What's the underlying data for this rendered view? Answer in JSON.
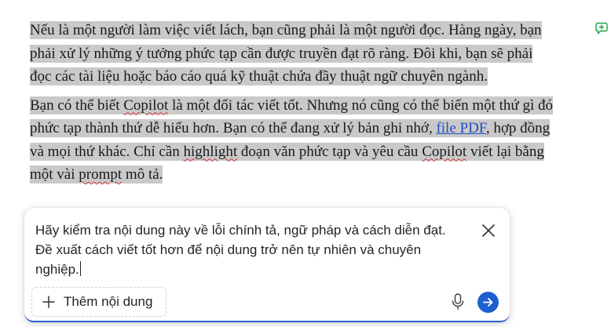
{
  "document": {
    "paragraph1": "Nếu là một người làm việc viết lách, bạn cũng phải là một người đọc. Hàng ngày, bạn phải xử lý những ý tưởng phức tạp cần được truyền đạt rõ ràng. Đôi khi, bạn sẽ phải đọc các tài liệu hoặc báo cáo quá kỹ thuật chứa đầy thuật ngữ chuyên ngành.",
    "paragraph2": {
      "part1": "Bạn có thể biết ",
      "spell1": "Copilot",
      "part2": " là một đối tác viết tốt. Nhưng nó cũng có thể biến một thứ gì đó phức tạp thành thứ dễ hiểu hơn. Bạn có thể đang xử lý bản ghi nhớ, ",
      "link": "file PDF",
      "part3": ", hợp đồng và mọi thứ khác. Chỉ cần ",
      "spell2": "highlight",
      "part4": " đoạn văn phức tạp và yêu cầu ",
      "spell3": "Copilot",
      "part5": " viết lại bằng một vài ",
      "spell4": "prompt",
      "part6": " mô tả."
    }
  },
  "copilot_panel": {
    "prompt_text": "Hãy kiểm tra nội dung này về lỗi chính tả, ngữ pháp và cách diễn đạt. Đề xuất cách viết tốt hơn để nội dung trở nên tự nhiên và chuyên nghiệp.",
    "add_content_label": "Thêm nội dung"
  },
  "colors": {
    "accent": "#1c5fd1",
    "selection": "#c9c9c9",
    "link": "#1f4fbf",
    "comment_icon": "#1a9e3f"
  },
  "icons": [
    "comment-add-icon",
    "close-icon",
    "plus-icon",
    "mic-icon",
    "send-arrow-icon"
  ]
}
